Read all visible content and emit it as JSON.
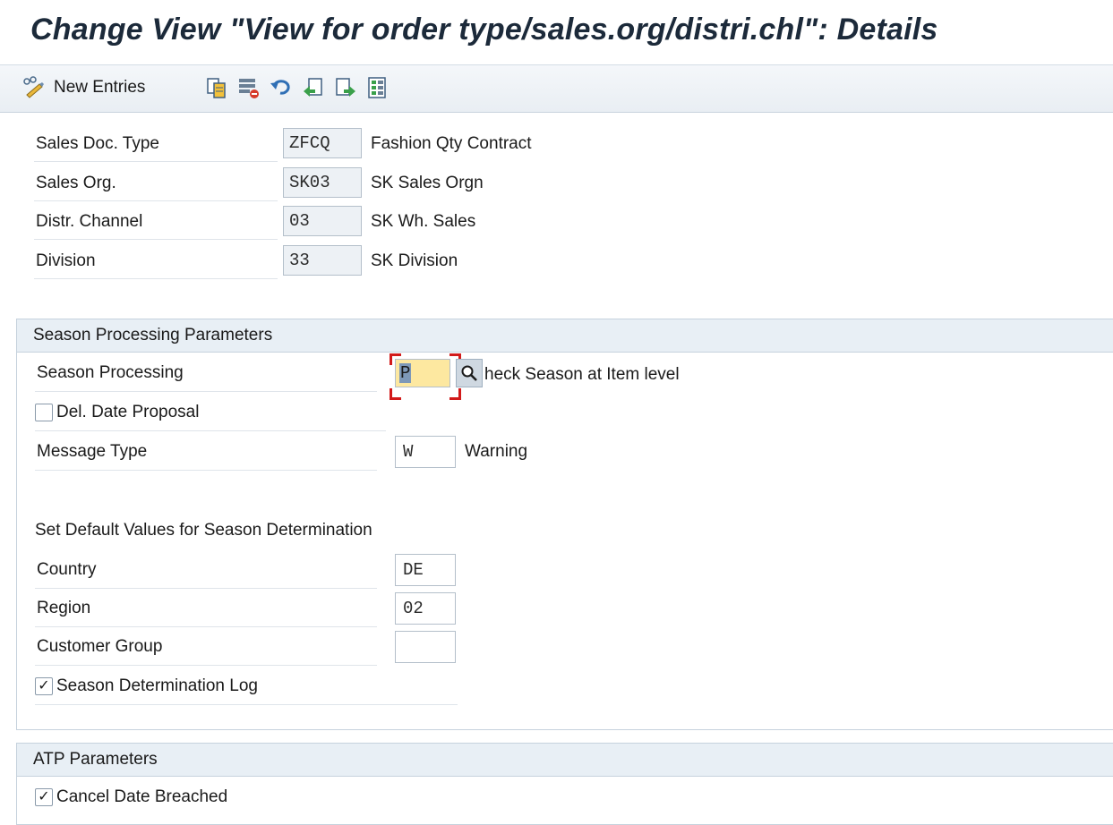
{
  "title": "Change View \"View for order type/sales.org/distri.chl\": Details",
  "toolbar": {
    "new_entries_label": "New Entries",
    "icons": [
      "new-entries-icon",
      "copy-icon",
      "delete-icon",
      "undo-icon",
      "previous-entry-icon",
      "next-entry-icon",
      "select-all-icon"
    ]
  },
  "keys": [
    {
      "label": "Sales Doc. Type",
      "value": "ZFCQ",
      "desc": "Fashion Qty Contract"
    },
    {
      "label": "Sales Org.",
      "value": "SK03",
      "desc": "SK Sales Orgn"
    },
    {
      "label": "Distr. Channel",
      "value": "03",
      "desc": "SK Wh. Sales"
    },
    {
      "label": "Division",
      "value": "33",
      "desc": "SK Division"
    }
  ],
  "season": {
    "header": "Season Processing Parameters",
    "processing_label": "Season Processing",
    "processing_value": "P",
    "processing_desc": "heck Season at Item level",
    "del_date_label": "Del. Date Proposal",
    "del_date_checked": false,
    "message_type_label": "Message Type",
    "message_type_value": "W",
    "message_type_desc": "Warning",
    "defaults_heading": "Set Default Values for Season Determination",
    "country_label": "Country",
    "country_value": "DE",
    "region_label": "Region",
    "region_value": "02",
    "customer_group_label": "Customer Group",
    "customer_group_value": "",
    "log_label": "Season Determination Log",
    "log_checked": true
  },
  "atp": {
    "header": "ATP Parameters",
    "cancel_label": "Cancel Date Breached",
    "cancel_checked": true
  },
  "colors": {
    "focus_bg": "#fde8a0",
    "focus_bracket": "#d21a1a",
    "group_header_bg": "#e8eff5"
  }
}
